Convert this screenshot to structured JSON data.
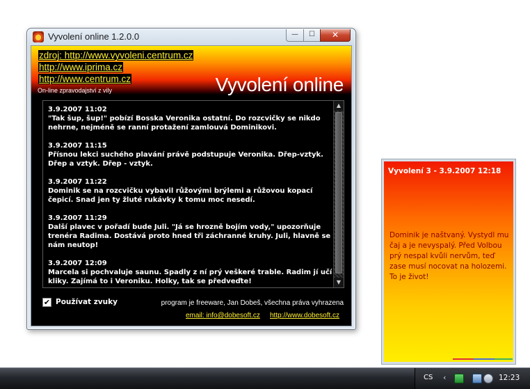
{
  "window": {
    "title": "Vyvolení online 1.2.0.0",
    "controls": {
      "minimize": "—",
      "maximize": "☐",
      "close": "✕"
    }
  },
  "header": {
    "links": [
      "zdroj: http://www.vyvoleni.centrum.cz",
      "http://www.iprima.cz",
      "http://www.centrum.cz"
    ],
    "tagline": "On-line zpravodajství z vily",
    "title": "Vyvolení online"
  },
  "news": [
    {
      "date": "3.9.2007 11:02",
      "text": "\"Tak šup, šup!\" pobízí Bosska Veronika ostatní. Do rozcvičky se nikdo nehrne, nejméně se ranní protažení zamlouvá Dominikovi."
    },
    {
      "date": "3.9.2007 11:15",
      "text": "Přísnou lekci suchého plavání právě podstupuje Veronika. Dřep-vztyk. Dřep a vztyk. Dřep - vztyk."
    },
    {
      "date": "3.9.2007 11:22",
      "text": "Dominik se na rozcvičku vybavil růžovými brýlemi a růžovou kopací čepicí. Snad jen ty žluté rukávky k tomu moc nesedí."
    },
    {
      "date": "3.9.2007 11:29",
      "text": "Další plavec v pořadí bude Juli. \"Já se hrozně bojím vody,\" upozorňuje trenéra Radima. Dostává proto hned tři záchranné kruhy. Juli, hlavně se nám neutop!"
    },
    {
      "date": "3.9.2007 12:09",
      "text": "Marcela si pochvaluje saunu. Spadly z ní prý veškeré trable. Radim jí učí kliky. Zajímá to i Veroniku. Holky, tak se předveďte!"
    }
  ],
  "footer": {
    "sound_label": "Používat zvuky",
    "sound_checked": true,
    "check_mark": "✔",
    "copyright": "program je freeware, Jan Dobeš, všechna práva vyhrazena",
    "email": "email: info@dobesoft.cz",
    "web": "http://www.dobesoft.cz"
  },
  "popup": {
    "title": "Vyvolení 3 - 3.9.2007 12:18",
    "message": "Dominik je naštvaný. Vystydl mu čaj a je nevyspalý. Před Volbou prý nespal kvůli nervům, teď zase musí nocovat na holozemi. To je život!"
  },
  "taskbar": {
    "language": "CS",
    "tray_chevron": "‹",
    "clock": "12:23"
  },
  "colors": {
    "header_top": "#ffe600",
    "header_mid": "#f22a00",
    "link": "#ffee33",
    "popup_top": "#f21a00",
    "popup_bottom": "#ffee00"
  }
}
